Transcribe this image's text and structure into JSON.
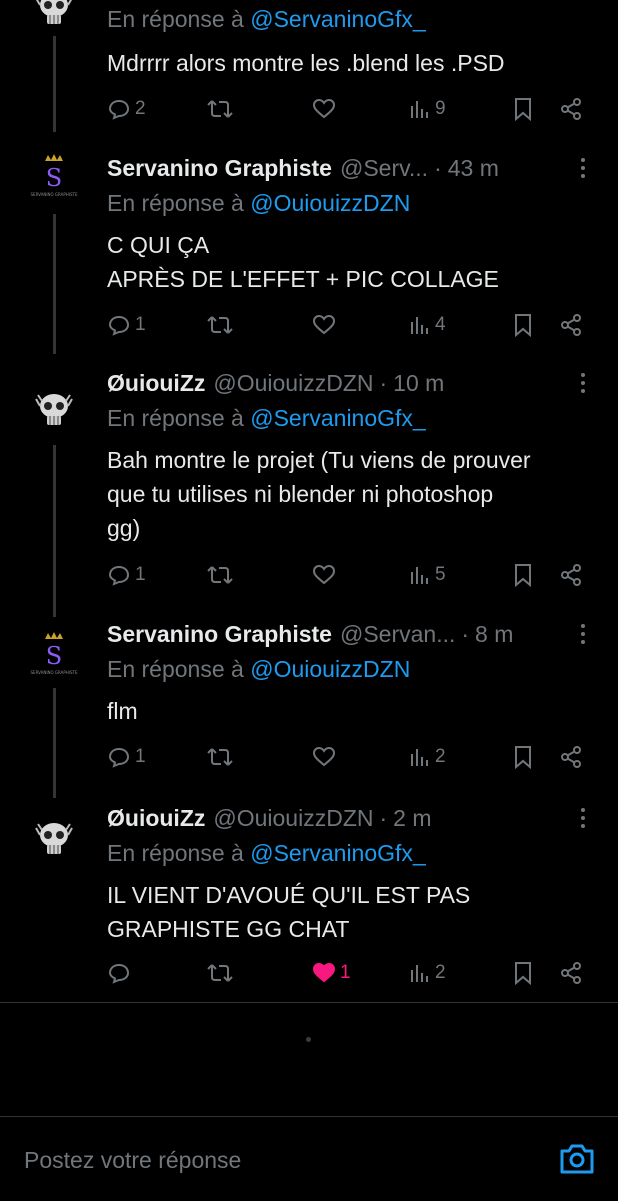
{
  "tweets": [
    {
      "name": "",
      "handle": "",
      "time": "",
      "reply_prefix": "En réponse à",
      "reply_mention": "@ServaninoGfx_",
      "text": "Mdrrrr alors montre les .blend les .PSD",
      "replies": "2",
      "retweets": "",
      "likes": "",
      "views": "9",
      "avatar": "skull-avatar",
      "liked": false
    },
    {
      "name": "Servanino Graphiste",
      "handle": "@Serv...",
      "time": "43 m",
      "reply_prefix": "En réponse à",
      "reply_mention": "@OuiouizzDZN",
      "text": "C QUI ÇA\nAPRÈS DE L'EFFET + PIC COLLAGE",
      "replies": "1",
      "retweets": "",
      "likes": "",
      "views": "4",
      "avatar": "servanino-logo",
      "liked": false
    },
    {
      "name": "ØuiouiZz",
      "handle": "@OuiouizzDZN",
      "time": "10 m",
      "reply_prefix": "En réponse à",
      "reply_mention": "@ServaninoGfx_",
      "text": "Bah montre le projet (Tu viens de prouver\nque tu utilises ni blender ni photoshop\ngg)",
      "replies": "1",
      "retweets": "",
      "likes": "",
      "views": "5",
      "avatar": "skull-avatar",
      "liked": false
    },
    {
      "name": "Servanino Graphiste",
      "handle": "@Servan...",
      "time": "8 m",
      "reply_prefix": "En réponse à",
      "reply_mention": "@OuiouizzDZN",
      "text": "flm",
      "replies": "1",
      "retweets": "",
      "likes": "",
      "views": "2",
      "avatar": "servanino-logo",
      "liked": false
    },
    {
      "name": "ØuiouiZz",
      "handle": "@OuiouizzDZN",
      "time": "2 m",
      "reply_prefix": "En réponse à",
      "reply_mention": "@ServaninoGfx_",
      "text": "IL VIENT D'AVOUÉ QU'IL EST PAS\nGRAPHISTE GG CHAT",
      "replies": "",
      "retweets": "",
      "likes": "1",
      "views": "2",
      "avatar": "skull-avatar",
      "liked": true
    }
  ],
  "logo_text": "SERVANINO GRAPHISTE",
  "reply_bar": {
    "placeholder": "Postez votre réponse"
  },
  "colors": {
    "background": "#000000",
    "text": "#e7e9ea",
    "muted": "#71767b",
    "link": "#1d9bf0",
    "like": "#f91880",
    "logo": "#8b5cf6"
  }
}
